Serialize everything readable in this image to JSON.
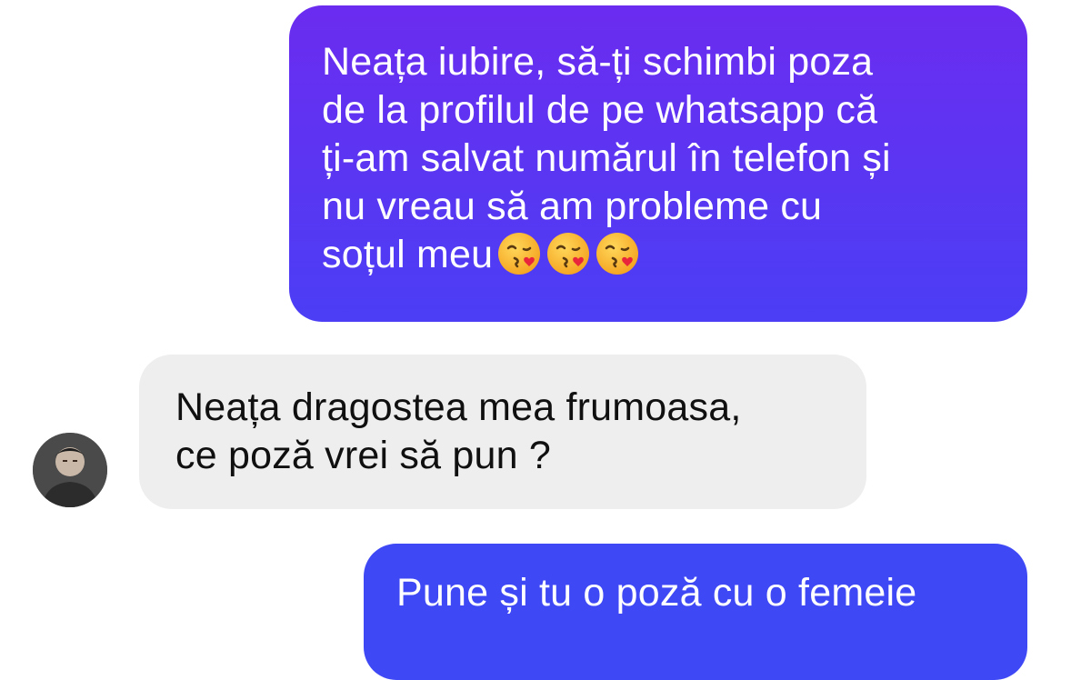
{
  "conversation": {
    "messages": [
      {
        "direction": "outgoing",
        "lines": [
          "Neața iubire, să-ți schimbi poza",
          "de la profilul de pe whatsapp că",
          "ți-am salvat numărul în telefon și",
          "nu vreau să am probleme cu",
          "soțul meu"
        ],
        "emojis": [
          "kissing-face-with-heart-icon",
          "kissing-face-with-heart-icon",
          "kissing-face-with-heart-icon"
        ]
      },
      {
        "direction": "incoming",
        "lines": [
          "Neața dragostea mea frumoasa,",
          "ce poză vrei să pun ?"
        ],
        "avatar": "contact-avatar"
      },
      {
        "direction": "outgoing",
        "lines": [
          "Pune și tu o poză cu o femeie"
        ]
      }
    ]
  },
  "colors": {
    "outgoing_bubble_top": "#6b2cf0",
    "outgoing_bubble_bottom": "#3f48f5",
    "incoming_bubble": "#eeeeee",
    "incoming_text": "#101010",
    "outgoing_text": "#ffffff"
  }
}
